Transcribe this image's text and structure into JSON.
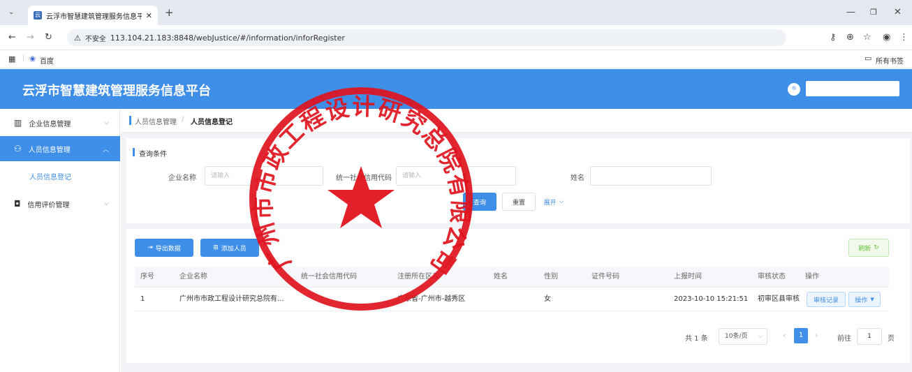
{
  "browser": {
    "tab_title": "云浮市智慧建筑管理服务信息平",
    "new_tab_label": "+",
    "security_label": "不安全",
    "url": "113.104.21.183:8848/webJustice/#/information/inforRegister",
    "bookmarks": [
      "百度"
    ],
    "all_bookmarks": "所有书签"
  },
  "header": {
    "title": "云浮市智慧建筑管理服务信息平台"
  },
  "sidebar": {
    "items": [
      {
        "label": "企业信息管理",
        "icon": "building-icon"
      },
      {
        "label": "人员信息管理",
        "icon": "people-icon",
        "active": true
      },
      {
        "label": "人员信息登记",
        "sub": true
      },
      {
        "label": "信用评价管理",
        "icon": "shield-icon"
      }
    ]
  },
  "breadcrumb": {
    "parent": "人员信息管理",
    "separator": "/",
    "current": "人员信息登记"
  },
  "query": {
    "title": "查询条件",
    "fields": [
      {
        "label": "企业名称",
        "placeholder": "请输入"
      },
      {
        "label": "统一社会信用代码",
        "placeholder": "请输入"
      },
      {
        "label": "姓名",
        "placeholder": ""
      }
    ],
    "search_label": "查询",
    "reset_label": "重置",
    "expand_label": "展开"
  },
  "toolbar": {
    "export_label": "导出数据",
    "add_label": "添加人员",
    "refresh_label": "刷新"
  },
  "table": {
    "headers": [
      "序号",
      "企业名称",
      "统一社会信用代码",
      "注册所在区县",
      "姓名",
      "性别",
      "证件号码",
      "上报时间",
      "审核状态",
      "操作"
    ],
    "rows": [
      {
        "index": "1",
        "company": "广州市市政工程设计研究总院有...",
        "credit_code": "",
        "district": "广东省-广州市-越秀区",
        "name": "",
        "gender": "女",
        "id_number": "",
        "report_time": "2023-10-10 15:21:51",
        "status": "初审区县审核",
        "audit_btn": "审核记录",
        "op_btn": "操作"
      }
    ]
  },
  "pagination": {
    "total": "共 1 条",
    "page_size": "10条/页",
    "current_page": "1",
    "goto_label": "前往",
    "goto_value": "1",
    "page_unit": "页"
  },
  "stamp": {
    "text": "广州市市政工程设计研究总院有限公司"
  },
  "colors": {
    "primary": "#3f8ee8",
    "stamp": "#e0141e",
    "refresh_green": "#67c23a"
  }
}
